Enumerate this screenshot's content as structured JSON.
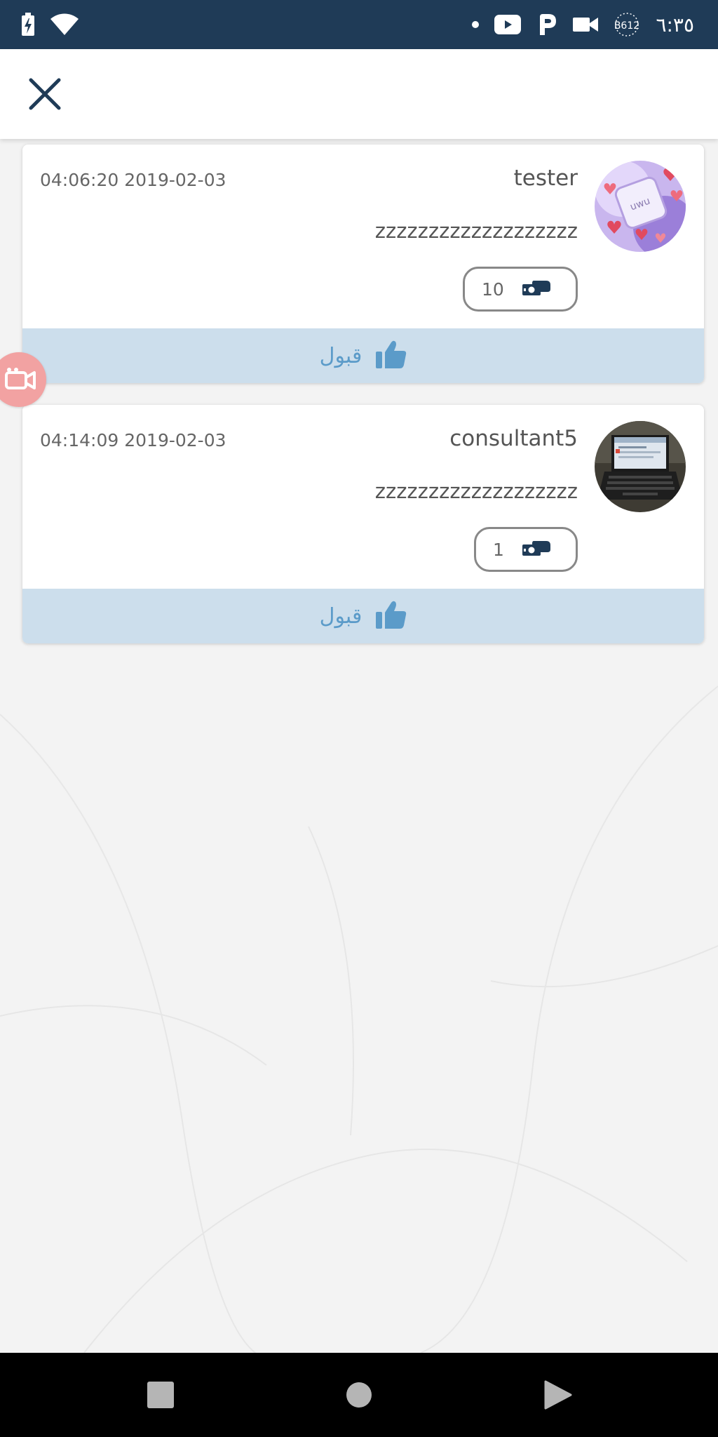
{
  "status_bar": {
    "time": "٦:٣٥",
    "carrier": "B612",
    "icons": [
      "battery-charging-icon",
      "wifi-icon",
      "notification-dot-icon",
      "youtube-icon",
      "parking-icon",
      "video-icon",
      "carrier-icon"
    ]
  },
  "header": {
    "close_icon": "close-icon"
  },
  "offers": [
    {
      "user_name": "tester",
      "timestamp": "04:06:20 2019-02-03",
      "message": "zzzzzzzzzzzzzzzzzzz",
      "amount": "10",
      "amount_icon": "money-hand-icon",
      "accept_label": "قبول",
      "accept_icon": "thumbs-up-icon"
    },
    {
      "user_name": "consultant5",
      "timestamp": "04:14:09 2019-02-03",
      "message": "zzzzzzzzzzzzzzzzzzz",
      "amount": "1",
      "amount_icon": "money-hand-icon",
      "accept_label": "قبول",
      "accept_icon": "thumbs-up-icon"
    }
  ],
  "floating_button": {
    "icon": "video-call-icon"
  },
  "navigation": {
    "items": [
      "recents-icon",
      "home-icon",
      "back-icon"
    ]
  },
  "colors": {
    "status_bar": "#1f3b57",
    "accent": "#5b9bc9",
    "footer": "#ccdeec",
    "background": "#f3f3f3"
  }
}
